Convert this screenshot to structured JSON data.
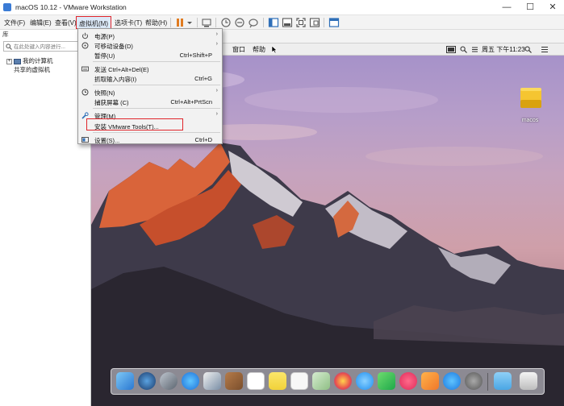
{
  "window": {
    "title": "macOS 10.12 - VMware Workstation",
    "minimize_glyph": "—",
    "maximize_glyph": "☐",
    "close_glyph": "✕"
  },
  "menubar": {
    "file": "文件(F)",
    "edit": "编辑(E)",
    "view": "查看(V)",
    "vm": "虚拟机(M)",
    "tabs": "选项卡(T)",
    "help": "帮助(H)"
  },
  "library": {
    "header": "库",
    "search_placeholder": "在此处键入内容进行...",
    "tree": [
      {
        "label": "我的计算机",
        "expander": "+"
      },
      {
        "label": "共享的虚拟机"
      }
    ]
  },
  "vm_menu": {
    "items": [
      {
        "label": "电源(P)",
        "shortcut": "",
        "submenu": true,
        "icon": "power-icon"
      },
      {
        "label": "可移动设备(D)",
        "shortcut": "",
        "submenu": true,
        "icon": "removable-devices-icon"
      },
      {
        "label": "暂停(U)",
        "shortcut": "Ctrl+Shift+P",
        "submenu": false,
        "icon": ""
      },
      {
        "label": "发送 Ctrl+Alt+Del(E)",
        "shortcut": "",
        "submenu": false,
        "icon": "keyboard-icon"
      },
      {
        "label": "抓取输入内容(I)",
        "shortcut": "Ctrl+G",
        "submenu": false,
        "icon": ""
      },
      {
        "label": "快照(N)",
        "shortcut": "",
        "submenu": true,
        "icon": "snapshot-icon"
      },
      {
        "label": "捕获屏幕 (C)",
        "shortcut": "Ctrl+Alt+PrtScn",
        "submenu": false,
        "icon": ""
      },
      {
        "label": "管理(M)",
        "shortcut": "",
        "submenu": true,
        "icon": "wrench-icon"
      },
      {
        "label": "安装 VMware Tools(T)...",
        "shortcut": "",
        "submenu": false,
        "icon": ""
      },
      {
        "label": "设置(S)...",
        "shortcut": "Ctrl+D",
        "submenu": false,
        "icon": "settings-icon"
      }
    ],
    "submenu_arrow": "›"
  },
  "guest": {
    "menus": [
      "窗口",
      "帮助"
    ],
    "clock": "周五 下午11:23",
    "desktop_icon_label": "macos"
  },
  "colors": {
    "highlight": "#e0252b",
    "menu_active_bg": "#dce9f8"
  }
}
